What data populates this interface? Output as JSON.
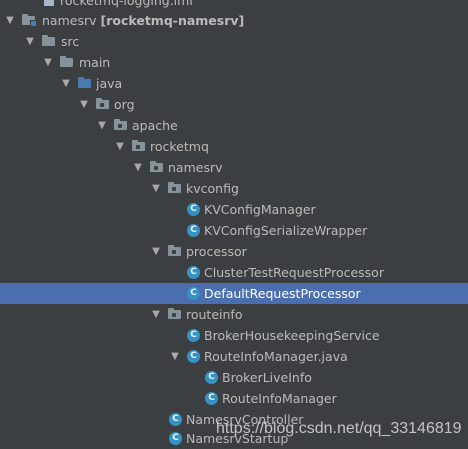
{
  "tree": {
    "rows": [
      {
        "label": "rocketmq-logging.iml"
      },
      {
        "label": "namesrv",
        "suffix": "[rocketmq-namesrv]"
      },
      {
        "label": "src"
      },
      {
        "label": "main"
      },
      {
        "label": "java"
      },
      {
        "label": "org"
      },
      {
        "label": "apache"
      },
      {
        "label": "rocketmq"
      },
      {
        "label": "namesrv"
      },
      {
        "label": "kvconfig"
      },
      {
        "label": "KVConfigManager",
        "icon_text": "C"
      },
      {
        "label": "KVConfigSerializeWrapper",
        "icon_text": "C"
      },
      {
        "label": "processor"
      },
      {
        "label": "ClusterTestRequestProcessor",
        "icon_text": "C"
      },
      {
        "label": "DefaultRequestProcessor",
        "icon_text": "C"
      },
      {
        "label": "routeinfo"
      },
      {
        "label": "BrokerHousekeepingService",
        "icon_text": "C"
      },
      {
        "label": "RouteInfoManager.java",
        "icon_text": "C"
      },
      {
        "label": "BrokerLiveInfo",
        "icon_text": "C"
      },
      {
        "label": "RouteInfoManager",
        "icon_text": "C"
      },
      {
        "label": "NamesrvController",
        "icon_text": "C"
      },
      {
        "label": "NamesrvStartup",
        "icon_text": "C"
      }
    ],
    "expand_glyph": "▼",
    "selected_row": "DefaultRequestProcessor"
  },
  "watermark": "https://blog.csdn.net/qq_33146819",
  "colors": {
    "background": "#3c3f41",
    "selection": "#4b6eaf",
    "class_icon": "#3592c4",
    "source_folder": "#4a7bb0",
    "package_folder": "#87939a"
  }
}
